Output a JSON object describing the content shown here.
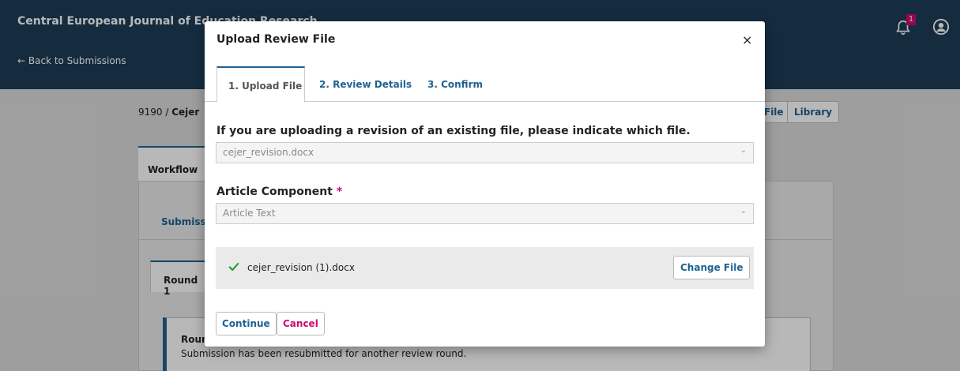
{
  "header": {
    "journal_title": "Central European Journal of Education Research",
    "back_link": "← Back to Submissions",
    "notification_count": "1"
  },
  "page": {
    "submission_id": "9190",
    "submission_sep": " / ",
    "submission_author": "Cejer",
    "file_button": "File",
    "library_button": "Library",
    "workflow_tab": "Workflow",
    "submission_tab": "Submission",
    "round_tab": "Round 1",
    "notice_title": "Round 1 Status",
    "notice_text": "Submission has been resubmitted for another review round."
  },
  "modal": {
    "title": "Upload Review File",
    "close_symbol": "×",
    "tabs": [
      {
        "label": "1. Upload File"
      },
      {
        "label": "2. Review Details"
      },
      {
        "label": "3. Confirm"
      }
    ],
    "revision_label": "If you are uploading a revision of an existing file, please indicate which file.",
    "revision_value": "cejer_revision.docx",
    "component_label": "Article Component",
    "required_mark": "*",
    "component_value": "Article Text",
    "uploaded_file": "cejer_revision (1).docx",
    "change_file_button": "Change File",
    "continue_button": "Continue",
    "cancel_button": "Cancel"
  },
  "colors": {
    "header_bg": "#1e3e58",
    "link": "#1e6292",
    "accent_pink": "#d00a6c",
    "check_green": "#00a86b"
  },
  "icons": {
    "bell": "bell-icon",
    "user": "user-icon",
    "close": "close-icon",
    "chevron": "chevron-down-icon",
    "check": "check-icon"
  }
}
